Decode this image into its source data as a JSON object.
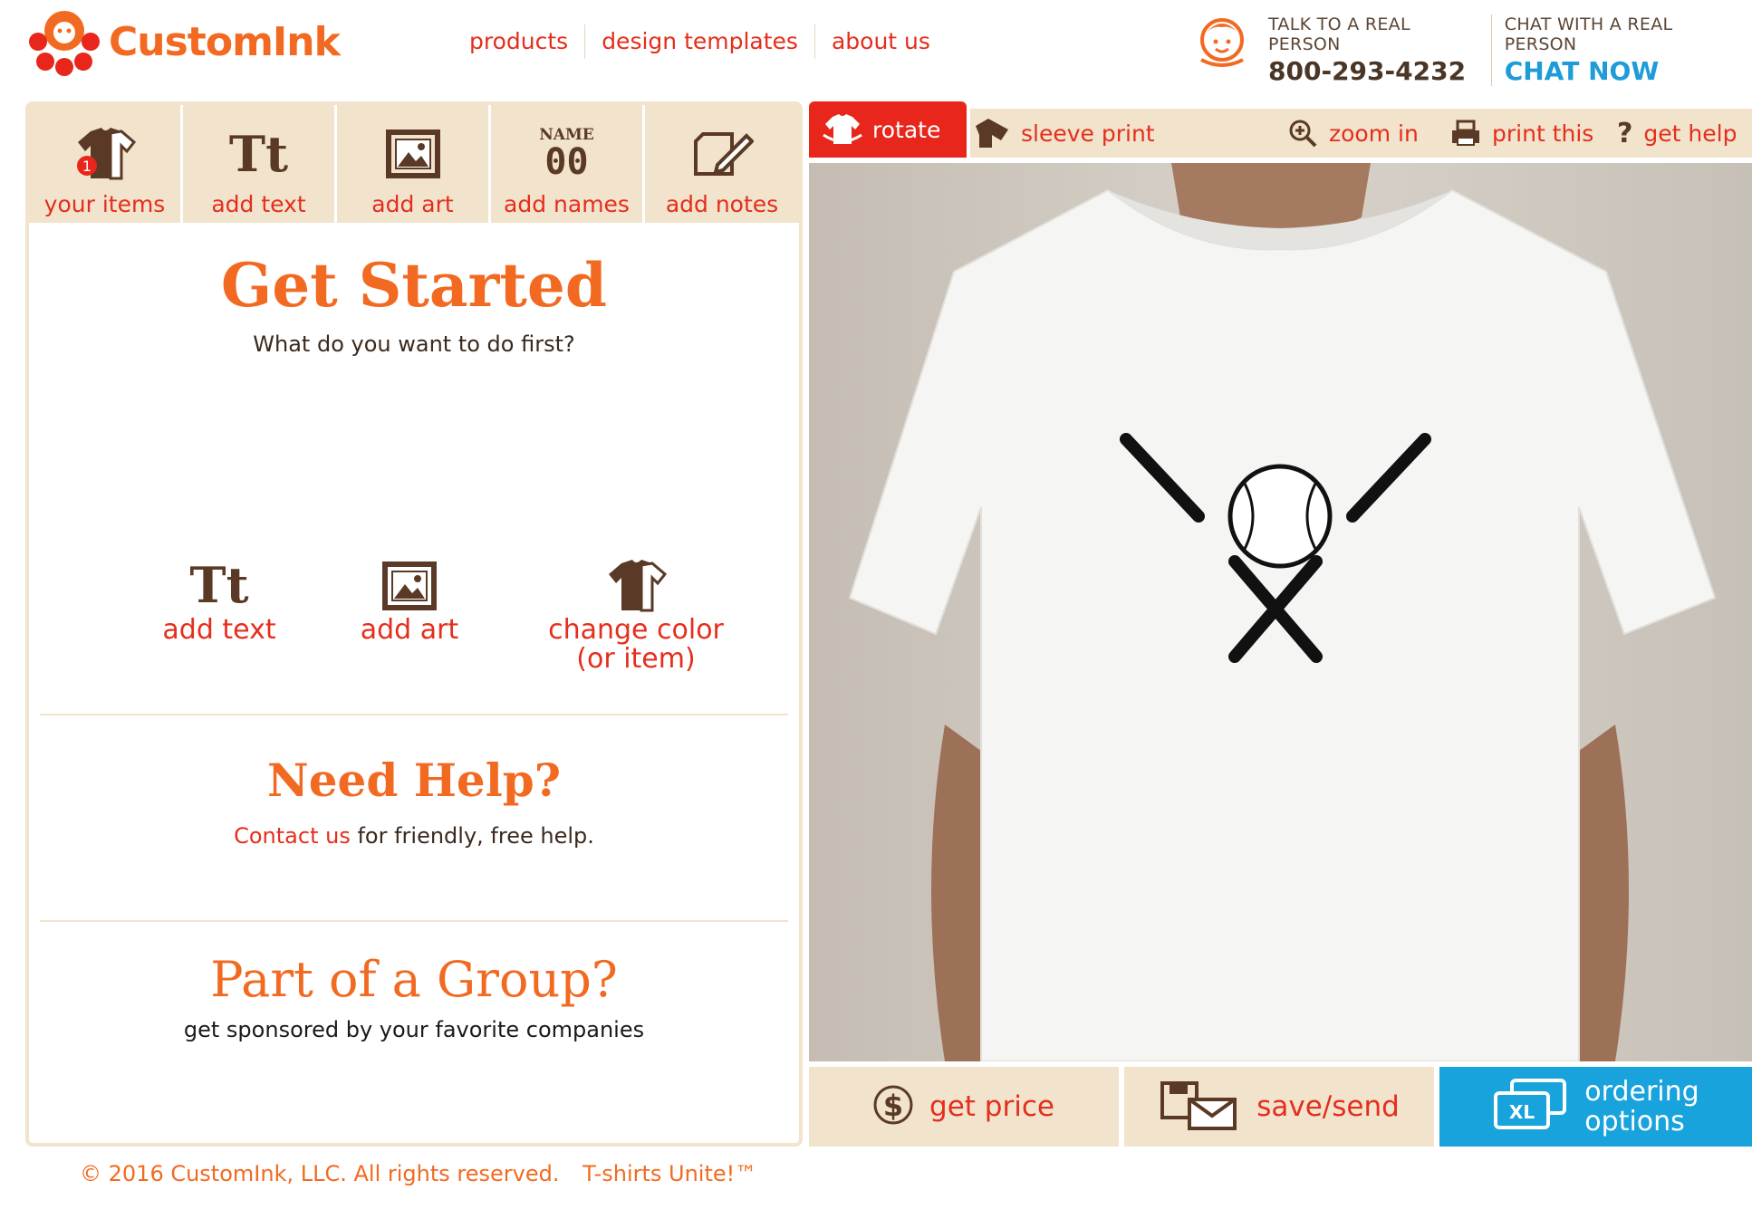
{
  "brand": {
    "name": "CustomInk"
  },
  "nav": {
    "products": "products",
    "design_templates": "design templates",
    "about_us": "about us"
  },
  "contact": {
    "talk_label": "TALK TO A REAL PERSON",
    "phone": "800-293-4232",
    "chat_label": "CHAT WITH A REAL PERSON",
    "chat_now": "CHAT NOW"
  },
  "toolbar": {
    "your_items": "your items",
    "your_items_badge": "1",
    "add_text": "add text",
    "add_art": "add art",
    "add_names": "add names",
    "add_names_icon_top": "NAME",
    "add_names_icon_bottom": "00",
    "add_notes": "add notes"
  },
  "get_started": {
    "title": "Get Started",
    "subtitle": "What do you want to do first?",
    "add_text": "add text",
    "add_art": "add art",
    "change_color": "change color",
    "change_color_sub": "(or item)",
    "tt_glyph": "Tt"
  },
  "help": {
    "title": "Need Help?",
    "link": "Contact us",
    "rest": "for friendly, free help."
  },
  "group": {
    "title": "Part of a Group?",
    "line": "get sponsored by your favorite companies"
  },
  "viewer": {
    "rotate": "rotate",
    "sleeve_print": "sleeve print",
    "zoom_in": "zoom in",
    "print_this": "print this",
    "get_help": "get help"
  },
  "actions": {
    "get_price": "get price",
    "save_send": "save/send",
    "ordering_line1": "ordering",
    "ordering_line2": "options",
    "xl_badge": "XL"
  },
  "footer": {
    "copyright": "© 2016 CustomInk, LLC. All rights reserved.",
    "tagline": "T-shirts Unite!™"
  },
  "colors": {
    "accent": "#e52e1c",
    "orange": "#f26a21",
    "beige": "#f1e3cc",
    "blue": "#19a3dd"
  }
}
